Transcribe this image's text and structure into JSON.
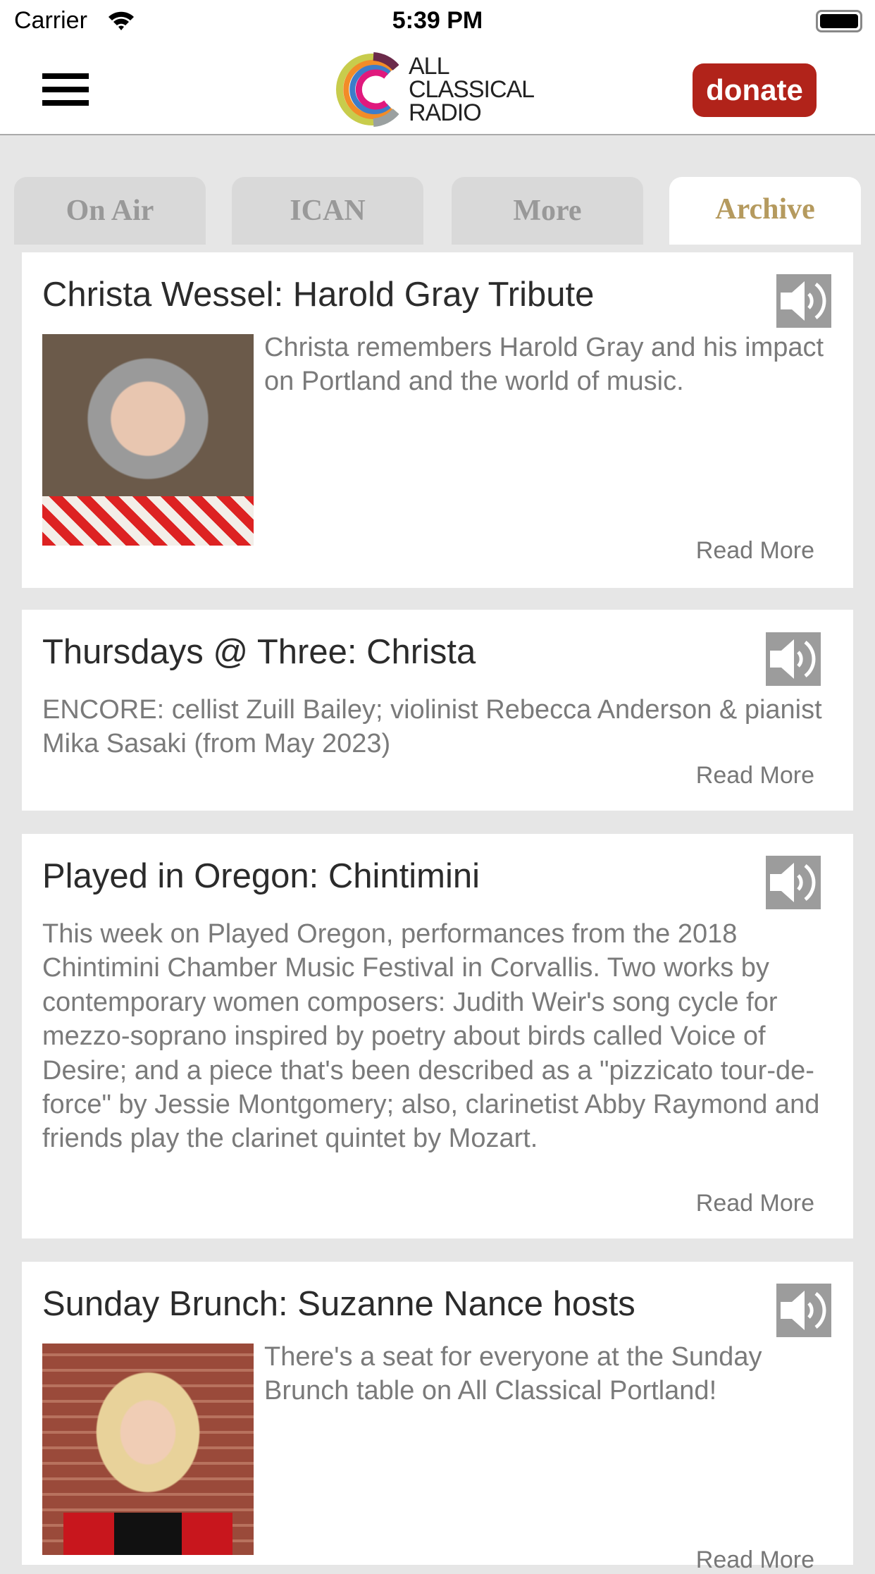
{
  "status_bar": {
    "carrier": "Carrier",
    "time": "5:39 PM"
  },
  "header": {
    "logo_lines": [
      "ALL",
      "CLASSICAL",
      "RADIO"
    ],
    "donate_label": "donate"
  },
  "tabs": [
    {
      "label": "On Air"
    },
    {
      "label": "ICAN"
    },
    {
      "label": "More"
    },
    {
      "label": "Archive",
      "active": true
    }
  ],
  "colors": {
    "donate": "#b1231a",
    "active_tab": "#b59a5e",
    "speaker": "#9c9c9c"
  },
  "cards": [
    {
      "title": "Christa Wessel: Harold Gray Tribute",
      "description": "Christa remembers Harold Gray and his impact on Portland and the world of music.",
      "read_more": "Read More",
      "has_photo": true,
      "icon": "speaker-icon"
    },
    {
      "title": "Thursdays @ Three: Christa",
      "description": "ENCORE: cellist Zuill Bailey; violinist Rebecca Anderson & pianist Mika Sasaki (from May 2023)",
      "read_more": "Read More",
      "has_photo": false,
      "icon": "speaker-icon"
    },
    {
      "title": "Played in Oregon: Chintimini",
      "description": "This week on Played Oregon, performances from the 2018 Chintimini Chamber Music Festival in Corvallis. Two works by contemporary women composers: Judith Weir's song cycle for mezzo-soprano inspired by poetry about birds called Voice of Desire; and a piece that's been described as a \"pizzicato tour-de-force\" by Jessie Montgomery; also, clarinetist Abby Raymond and friends play the clarinet quintet by Mozart.",
      "read_more": "Read More",
      "has_photo": false,
      "icon": "speaker-icon"
    },
    {
      "title": "Sunday Brunch: Suzanne Nance hosts",
      "description": "There's a seat for everyone at the Sunday Brunch table on All Classical Portland!",
      "read_more": "Read More",
      "has_photo": true,
      "icon": "speaker-icon"
    }
  ]
}
